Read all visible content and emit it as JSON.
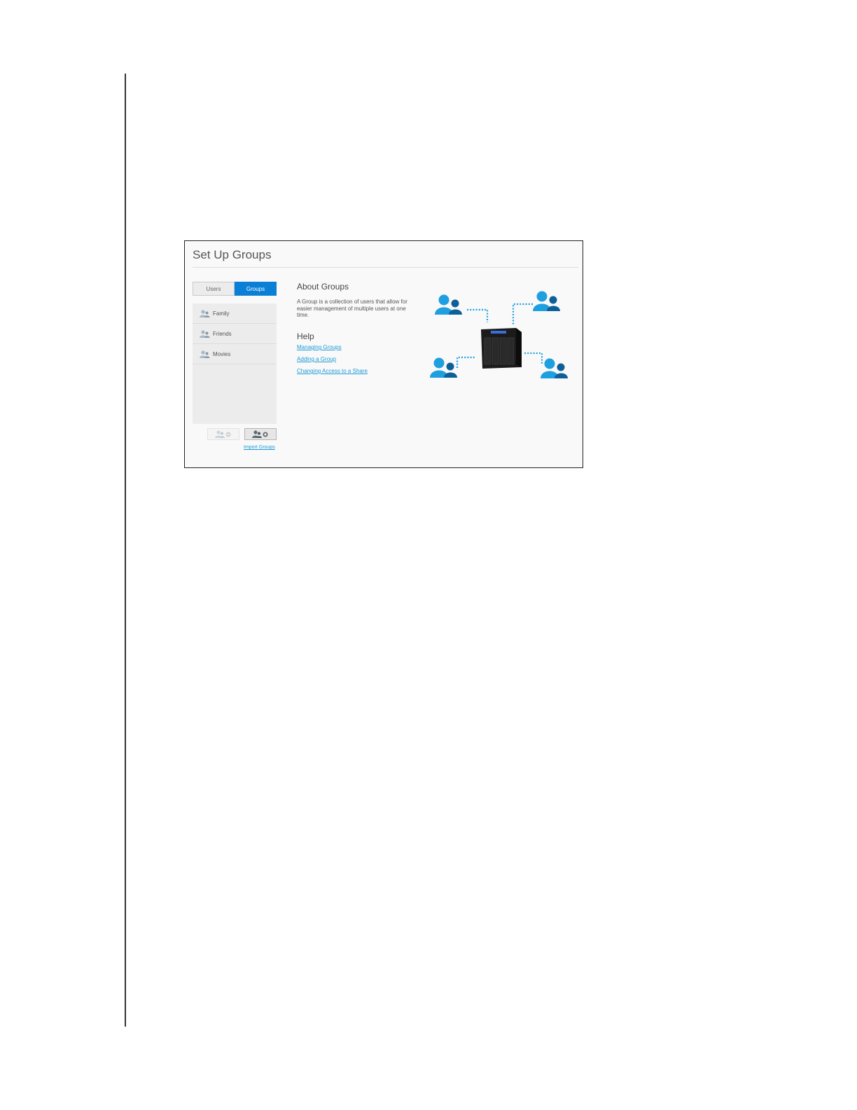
{
  "window": {
    "title": "Set Up Groups"
  },
  "tabs": [
    {
      "label": "Users",
      "active": false
    },
    {
      "label": "Groups",
      "active": true
    }
  ],
  "groups": [
    {
      "label": "Family",
      "icon": "group-icon"
    },
    {
      "label": "Friends",
      "icon": "group-icon"
    },
    {
      "label": "Movies",
      "icon": "group-icon"
    }
  ],
  "list_actions": {
    "remove_icon": "remove-group-icon",
    "add_icon": "add-group-icon",
    "import_link": "Import Groups"
  },
  "about": {
    "heading": "About Groups",
    "text": "A Group is a collection of users that allow for easier management of multiple users at one time."
  },
  "help": {
    "heading": "Help",
    "links": [
      "Managing Groups",
      "Adding a Group",
      "Changing Access to a Share"
    ]
  },
  "colors": {
    "accent": "#0a7fd6",
    "link": "#1b9ad6",
    "user_icon": "#1e9fe0",
    "user_icon_dark": "#0d5f9a"
  }
}
